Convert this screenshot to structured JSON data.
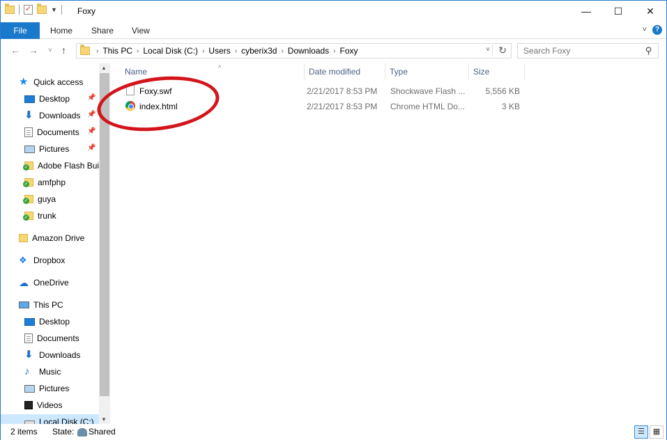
{
  "window": {
    "title": "Foxy"
  },
  "window_controls": {
    "minimize": "—",
    "maximize": "☐",
    "close": "✕"
  },
  "ribbon": {
    "tabs": [
      {
        "label": "File"
      },
      {
        "label": "Home"
      },
      {
        "label": "Share"
      },
      {
        "label": "View"
      }
    ],
    "expand_icon": "˅",
    "help": "?"
  },
  "nav_buttons": {
    "back": "←",
    "forward": "→",
    "recent": "˅",
    "up": "↑"
  },
  "address": {
    "crumbs": [
      "This PC",
      "Local Disk (C:)",
      "Users",
      "cyberix3d",
      "Downloads",
      "Foxy"
    ],
    "separator": "›",
    "dropdown": "˅",
    "refresh": "↻"
  },
  "search": {
    "placeholder": "Search Foxy",
    "icon": "⚲"
  },
  "navpane": {
    "quick_access": "Quick access",
    "items": [
      {
        "label": "Desktop"
      },
      {
        "label": "Downloads"
      },
      {
        "label": "Documents"
      },
      {
        "label": "Pictures"
      },
      {
        "label": "Adobe Flash Bui"
      },
      {
        "label": "amfphp"
      },
      {
        "label": "guya"
      },
      {
        "label": "trunk"
      }
    ],
    "amazon_drive": "Amazon Drive",
    "dropbox": "Dropbox",
    "onedrive": "OneDrive",
    "this_pc": "This PC",
    "pc_items": [
      {
        "label": "Desktop"
      },
      {
        "label": "Documents"
      },
      {
        "label": "Downloads"
      },
      {
        "label": "Music"
      },
      {
        "label": "Pictures"
      },
      {
        "label": "Videos"
      },
      {
        "label": "Local Disk (C:)"
      }
    ],
    "pin_icon": "📌"
  },
  "columns": {
    "name": "Name",
    "date": "Date modified",
    "type": "Type",
    "size": "Size"
  },
  "files": [
    {
      "name": "Foxy.swf",
      "date": "2/21/2017 8:53 PM",
      "type": "Shockwave Flash ...",
      "size": "5,556 KB"
    },
    {
      "name": "index.html",
      "date": "2/21/2017 8:53 PM",
      "type": "Chrome HTML Do...",
      "size": "3 KB"
    }
  ],
  "status": {
    "count": "2 items",
    "state_label": "State:",
    "state_value": "Shared"
  },
  "colors": {
    "accent": "#1979ca",
    "annotation": "#d4141b"
  }
}
